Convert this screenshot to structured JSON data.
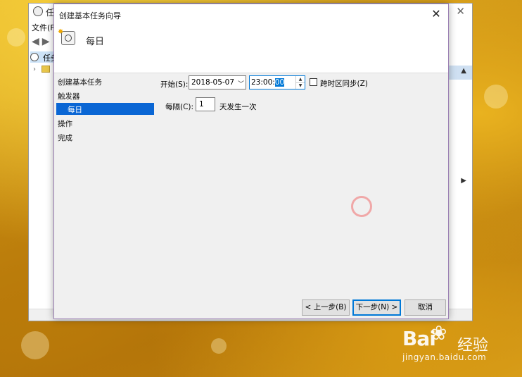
{
  "background_window": {
    "title": "任",
    "menu": "文件(F",
    "tree_label": "任务"
  },
  "dialog": {
    "title": "创建基本任务向导",
    "header_title": "每日",
    "steps": [
      "创建基本任务",
      "触发器",
      "每日",
      "操作",
      "完成"
    ],
    "active_step_index": 2
  },
  "form": {
    "start_label": "开始(S):",
    "start_date": "2018-05-07",
    "start_time_prefix": "23:00:",
    "start_time_selected": "00",
    "sync_timezone_label": "跨时区同步(Z)",
    "sync_timezone_checked": false,
    "every_label": "每隔(C):",
    "every_value": "1",
    "every_suffix": "天发生一次"
  },
  "buttons": {
    "back": "< 上一步(B)",
    "next": "下一步(N) >",
    "cancel": "取消"
  },
  "watermark": {
    "logo": "Bai",
    "logo_suffix": "经验",
    "url": "jingyan.baidu.com"
  },
  "colors": {
    "accent": "#0078d7",
    "selection": "#0a66d4",
    "dialog_bg": "#f0f0f0"
  }
}
